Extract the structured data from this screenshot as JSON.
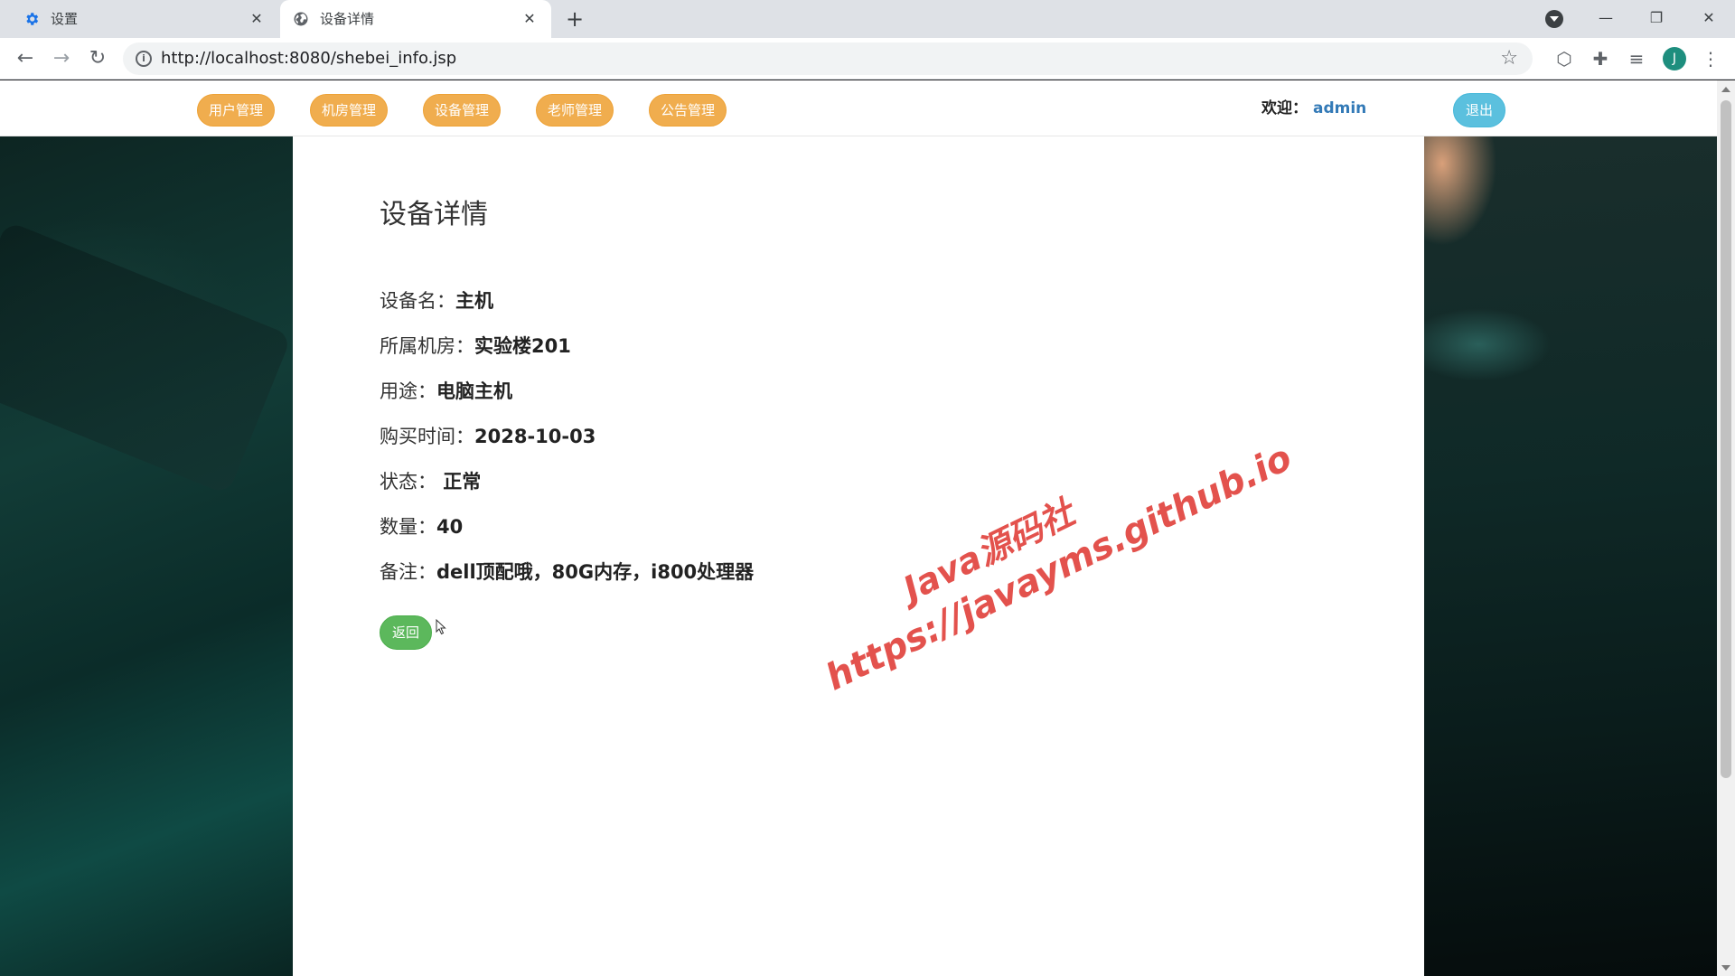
{
  "browser": {
    "tabs": [
      {
        "title": "设置",
        "active": false,
        "icon": "gear-icon"
      },
      {
        "title": "设备详情",
        "active": true,
        "icon": "globe-icon"
      }
    ],
    "url": "http://localhost:8080/shebei_info.jsp",
    "profile_initial": "J"
  },
  "nav": {
    "items": [
      {
        "label": "用户管理"
      },
      {
        "label": "机房管理"
      },
      {
        "label": "设备管理"
      },
      {
        "label": "老师管理"
      },
      {
        "label": "公告管理"
      }
    ],
    "welcome_label": "欢迎：",
    "username": "admin",
    "logout_label": "退出",
    "button_color": "#f0ad4e",
    "logout_color": "#5bc0de"
  },
  "detail": {
    "title": "设备详情",
    "fields": [
      {
        "label": "设备名：",
        "value": "主机"
      },
      {
        "label": "所属机房：",
        "value": "实验楼201"
      },
      {
        "label": "用途：",
        "value": "电脑主机"
      },
      {
        "label": "购买时间：",
        "value": "2028-10-03"
      },
      {
        "label": "状态：",
        "value": " 正常"
      },
      {
        "label": "数量：",
        "value": "40"
      },
      {
        "label": "备注：",
        "value": "dell顶配哦，80G内存，i800处理器"
      }
    ],
    "back_label": "返回",
    "back_color": "#5cb85c"
  },
  "watermark": {
    "line1": "Java源码社",
    "line2": "https://javayms.github.io",
    "color": "#e3524d"
  }
}
